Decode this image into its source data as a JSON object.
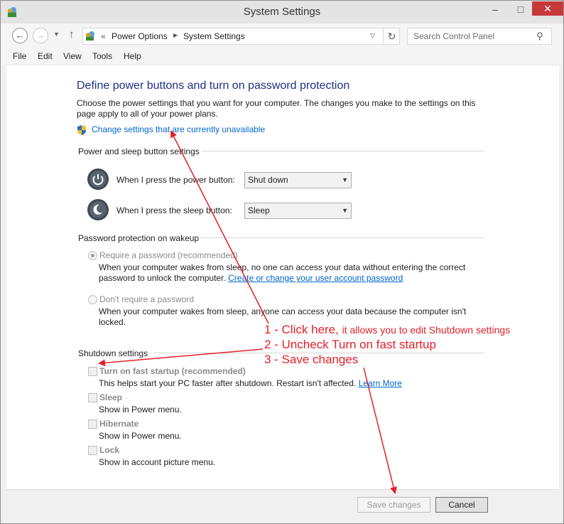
{
  "window": {
    "title": "System Settings",
    "minimize_glyph": "–",
    "maximize_glyph": "□",
    "close_glyph": "✕"
  },
  "nav": {
    "back_glyph": "←",
    "forward_glyph": "→",
    "recent_glyph": "▼",
    "up_glyph": "↑",
    "chevron": "«",
    "breadcrumbs": [
      "Power Options",
      "System Settings"
    ],
    "separator_glyph": "▶",
    "dropdown_glyph": "▽",
    "refresh_glyph": "↻",
    "search_placeholder": "Search Control Panel",
    "search_glyph": "⚲"
  },
  "menu": [
    "File",
    "Edit",
    "View",
    "Tools",
    "Help"
  ],
  "page": {
    "heading": "Define power buttons and turn on password protection",
    "description": "Choose the power settings that you want for your computer. The changes you make to the settings on this page apply to all of your power plans.",
    "change_link": "Change settings that are currently unavailable"
  },
  "power_section": {
    "title": "Power and sleep button settings",
    "power_label": "When I press the power button:",
    "power_value": "Shut down",
    "sleep_label": "When I press the sleep button:",
    "sleep_value": "Sleep",
    "arrow_glyph": "▼"
  },
  "password_section": {
    "title": "Password protection on wakeup",
    "require_label": "Require a password (recommended)",
    "require_desc_1": "When your computer wakes from sleep, no one can access your data without entering the correct",
    "require_desc_2": "password to unlock the computer.",
    "require_link": "Create or change your user account password",
    "norequire_label": "Don't require a password",
    "norequire_desc_1": "When your computer wakes from sleep, anyone can access your data because the computer isn't",
    "norequire_desc_2": "locked."
  },
  "shutdown_section": {
    "title": "Shutdown settings",
    "items": [
      {
        "label": "Turn on fast startup (recommended)",
        "desc": "This helps start your PC faster after shutdown. Restart isn't affected.",
        "link": "Learn More"
      },
      {
        "label": "Sleep",
        "desc": "Show in Power menu."
      },
      {
        "label": "Hibernate",
        "desc": "Show in Power menu."
      },
      {
        "label": "Lock",
        "desc": "Show in account picture menu."
      }
    ]
  },
  "buttons": {
    "save": "Save changes",
    "cancel": "Cancel"
  },
  "annotations": {
    "step1_big": "1 - Click here,",
    "step1_small": "it allows you to edit Shutdown settings",
    "step2": "2 - Uncheck Turn on fast startup",
    "step3": "3 - Save changes",
    "color": "#e4202a"
  }
}
